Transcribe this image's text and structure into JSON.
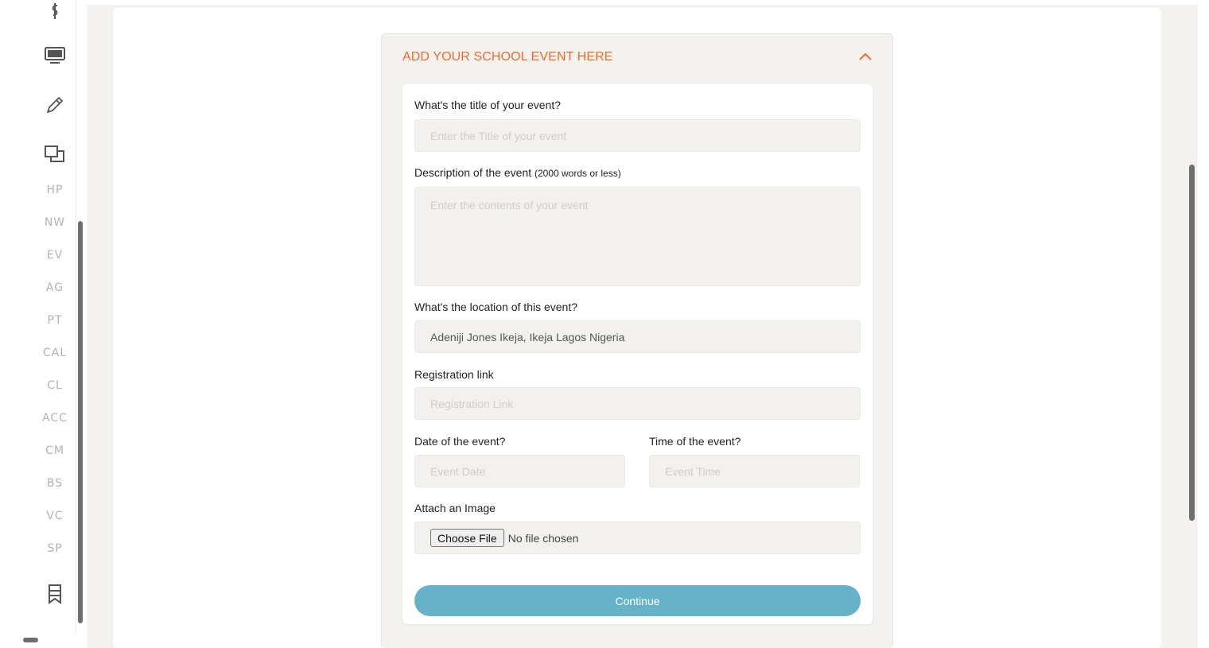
{
  "sidebar": {
    "icons": [
      "dollar-icon",
      "monitor-icon",
      "pencil-icon",
      "copy-icon"
    ],
    "items": [
      {
        "label": "HP"
      },
      {
        "label": "NW"
      },
      {
        "label": "EV"
      },
      {
        "label": "AG"
      },
      {
        "label": "PT"
      },
      {
        "label": "CAL"
      },
      {
        "label": "CL"
      },
      {
        "label": "ACC"
      },
      {
        "label": "CM"
      },
      {
        "label": "BS"
      },
      {
        "label": "VC"
      },
      {
        "label": "SP"
      }
    ],
    "bottom_icon": "bookmark-icon"
  },
  "panel": {
    "title": "ADD YOUR SCHOOL EVENT HERE",
    "collapse_icon": "chevron-up-icon",
    "accent_color": "#f26b2a"
  },
  "form": {
    "title_label": "What's the title of your event?",
    "title_placeholder": "Enter the Title of your event",
    "description_label": "Description of the event",
    "description_hint": "(2000 words or less)",
    "description_placeholder": "Enter the contents of your event",
    "location_label": "What's the location of this event?",
    "location_value": "Adeniji Jones Ikeja, Ikeja Lagos Nigeria",
    "registration_label": "Registration link",
    "registration_placeholder": "Registration Link",
    "date_label": "Date of the event?",
    "date_placeholder": "Event Date",
    "time_label": "Time of the event?",
    "time_placeholder": "Event Time",
    "image_label": "Attach an Image",
    "choose_file_label": "Choose File",
    "file_status": "No file chosen",
    "continue_label": "Continue",
    "button_color": "#66b3c9"
  }
}
